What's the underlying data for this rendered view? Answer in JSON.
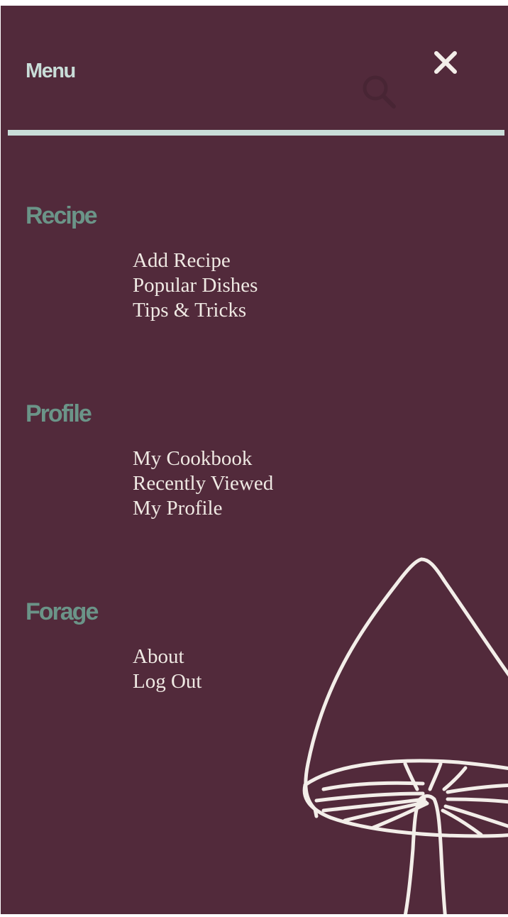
{
  "header": {
    "title": "Menu",
    "close_glyph": "✕",
    "search_icon": "search-icon"
  },
  "sections": [
    {
      "heading": "Recipe",
      "links": [
        "Add Recipe",
        "Popular Dishes",
        "Tips & Tricks"
      ]
    },
    {
      "heading": "Profile",
      "links": [
        "My Cookbook",
        "Recently Viewed",
        "My Profile"
      ]
    },
    {
      "heading": "Forage",
      "links": [
        "About",
        "Log Out"
      ]
    }
  ],
  "decoration": {
    "illustration": "mushroom-illustration"
  },
  "colors": {
    "background": "#522a3b",
    "header_text": "#c9ddd8",
    "section_heading": "#6b9488",
    "link_text": "#efe9e3",
    "divider": "#c9ddd8",
    "illustration_stroke": "#f3eee9"
  }
}
